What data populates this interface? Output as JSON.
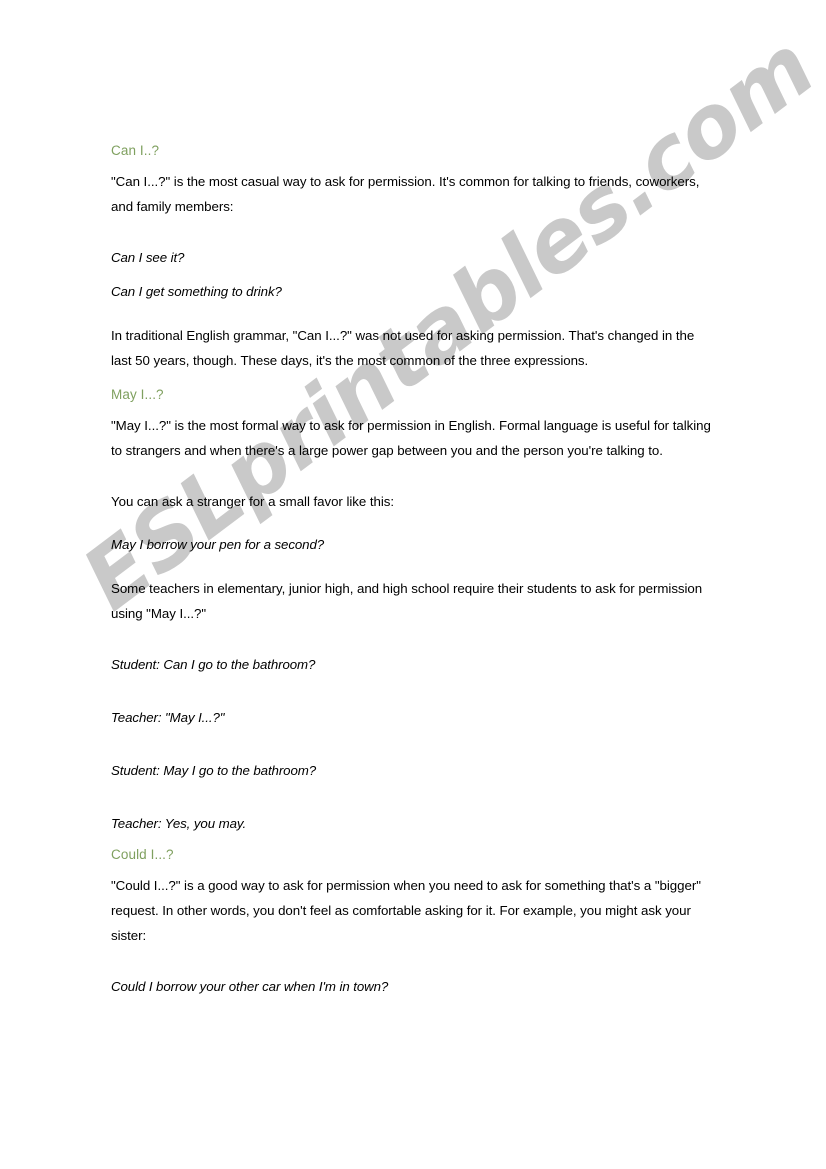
{
  "document": {
    "watermark": "ESLprintables.com",
    "watermark_color": "#c9c9c9",
    "heading_color": "#7fa05f",
    "body_color": "#000000",
    "page_background": "#ffffff"
  },
  "sections": [
    {
      "heading": "Can I..?",
      "blocks": [
        {
          "type": "paragraph",
          "text": "\"Can I...?\" is the most casual way to ask for permission. It's common for talking to friends, coworkers, and family members:"
        },
        {
          "type": "example",
          "text": "Can I see it?"
        },
        {
          "type": "example",
          "text": "Can I get something to drink?"
        },
        {
          "type": "paragraph",
          "text": "In traditional English grammar, \"Can I...?\" was not used for asking permission. That's changed in the last 50 years, though. These days, it's the most common of the three expressions."
        }
      ]
    },
    {
      "heading": "May I...?",
      "blocks": [
        {
          "type": "paragraph",
          "text": "\"May I...?\" is the most formal way to ask for permission in English. Formal language is useful for talking to strangers and when there's a large power gap between you and the person you're talking to."
        },
        {
          "type": "paragraph",
          "text": "You can ask a stranger for a small favor like this:"
        },
        {
          "type": "example",
          "text": "May I borrow your pen for a second?"
        },
        {
          "type": "paragraph",
          "text": "Some teachers in elementary, junior high, and high school require their students to ask for permission using \"May I...?\""
        },
        {
          "type": "example",
          "text": "Student: Can I go to the bathroom?"
        },
        {
          "type": "example",
          "text": "Teacher: \"May I...?\""
        },
        {
          "type": "example",
          "text": "Student: May I go to the bathroom?"
        },
        {
          "type": "example",
          "text": "Teacher: Yes, you may."
        }
      ]
    },
    {
      "heading": "Could I...?",
      "blocks": [
        {
          "type": "paragraph",
          "text": "\"Could I...?\" is a good way to ask for permission when you need to ask for something that's a \"bigger\" request. In other words, you don't feel as comfortable asking for it. For example, you might ask your sister:"
        },
        {
          "type": "example",
          "text": "Could I borrow your other car when I'm in town?"
        }
      ]
    }
  ]
}
